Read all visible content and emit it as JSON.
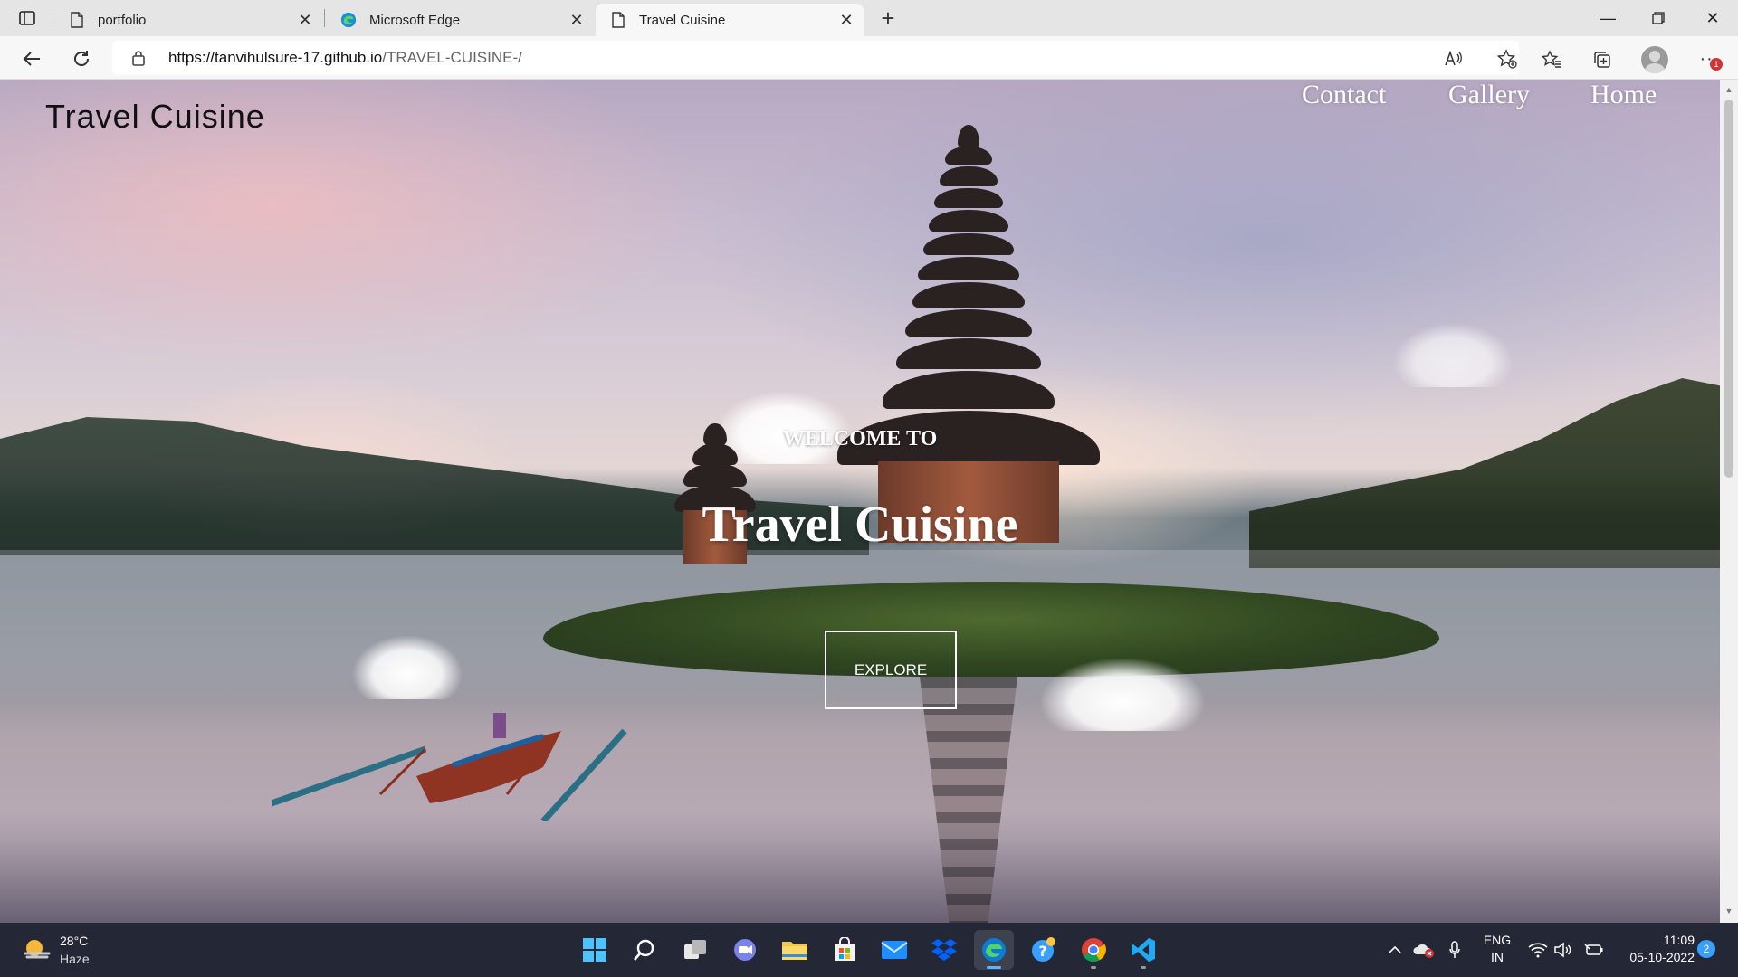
{
  "browser": {
    "tabs": [
      {
        "label": "portfolio",
        "icon": "page-icon"
      },
      {
        "label": "Microsoft Edge",
        "icon": "edge-icon"
      },
      {
        "label": "Travel Cuisine",
        "icon": "page-icon",
        "active": true
      }
    ],
    "url_host": "https://tanvihulsure-17.github.io",
    "url_path": "/TRAVEL-CUISINE-/",
    "more_label": "···",
    "notification_count": "1"
  },
  "page": {
    "brand": "Travel  Cuisine",
    "nav": [
      "Contact",
      "Gallery",
      "Home"
    ],
    "welcome": "WELCOME TO",
    "title": "Travel Cuisine",
    "cta": "EXPLORE"
  },
  "taskbar": {
    "weather_temp": "28°C",
    "weather_desc": "Haze",
    "lang_top": "ENG",
    "lang_bottom": "IN",
    "time": "11:09",
    "date": "05-10-2022",
    "notification_count": "2",
    "apps": [
      "windows-start-icon",
      "search-icon",
      "task-view-icon",
      "teams-chat-icon",
      "file-explorer-icon",
      "microsoft-store-icon",
      "mail-icon",
      "dropbox-icon",
      "edge-icon",
      "get-help-icon",
      "chrome-icon",
      "vscode-icon"
    ]
  },
  "colors": {
    "taskbar_bg": "#242736",
    "active_indicator": "#5fb2ff",
    "badge_red": "#d13438"
  }
}
